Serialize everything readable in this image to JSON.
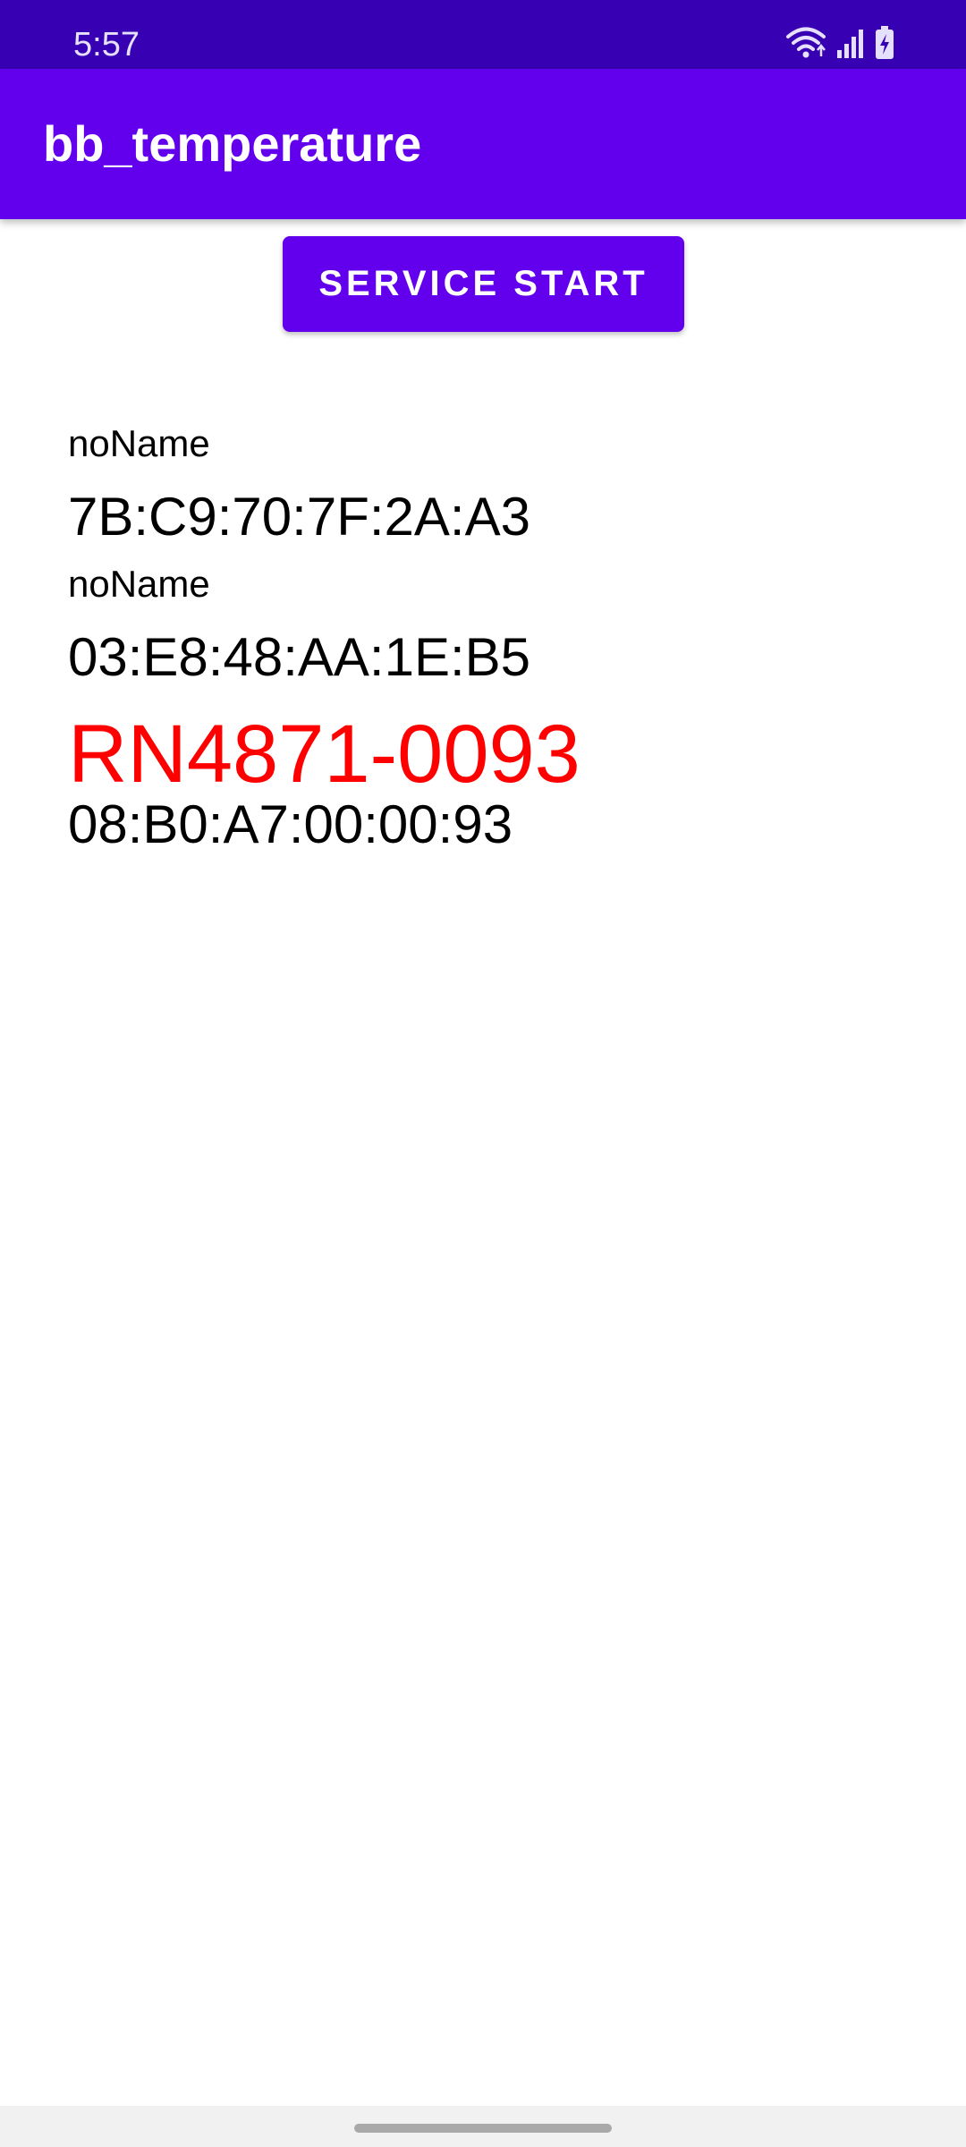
{
  "status_bar": {
    "time": "5:57",
    "icons": [
      "wifi-icon",
      "signal-icon",
      "battery-charging-icon"
    ]
  },
  "app_bar": {
    "title": "bb_temperature"
  },
  "service_button": {
    "label": "SERVICE START"
  },
  "devices": [
    {
      "name": "noName",
      "address": "7B:C9:70:7F:2A:A3",
      "highlight": false
    },
    {
      "name": "noName",
      "address": "03:E8:48:AA:1E:B5",
      "highlight": false
    },
    {
      "name": "RN4871-0093",
      "address": "08:B0:A7:00:00:93",
      "highlight": true
    }
  ],
  "colors": {
    "status_bar": "#3700B3",
    "primary": "#6200EE",
    "highlight_name": "#FF0000"
  }
}
